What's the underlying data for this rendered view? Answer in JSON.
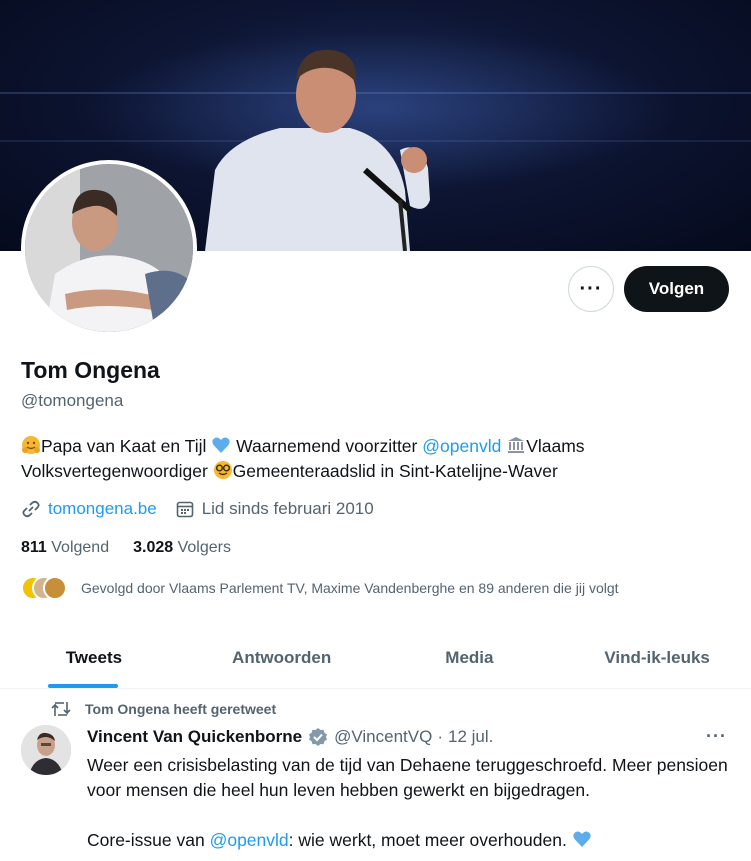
{
  "profile": {
    "name": "Tom Ongena",
    "handle": "@tomongena",
    "bio": {
      "part1": "Papa van Kaat en Tijl",
      "part2": "Waarnemend voorzitter",
      "mention": "@openvld",
      "part3": "Vlaams Volksvertegenwoordiger",
      "part4": "Gemeenteraadslid in Sint-Katelijne-Waver"
    },
    "website": "tomongena.be",
    "joined": "Lid sinds februari 2010",
    "following_count": "811",
    "following_label": "Volgend",
    "followers_count": "3.028",
    "followers_label": "Volgers",
    "followed_by": "Gevolgd door Vlaams Parlement TV, Maxime Vandenberghe en 89 anderen die jij volgt"
  },
  "actions": {
    "more_label": "···",
    "follow_label": "Volgen"
  },
  "tabs": [
    {
      "label": "Tweets",
      "active": true
    },
    {
      "label": "Antwoorden",
      "active": false
    },
    {
      "label": "Media",
      "active": false
    },
    {
      "label": "Vind-ik-leuks",
      "active": false
    }
  ],
  "tweet": {
    "retweeted_by": "Tom Ongena heeft geretweet",
    "author": "Vincent Van Quickenborne",
    "author_handle": "@VincentVQ",
    "separator": "·",
    "date": "12 jul.",
    "line1": "Weer een crisisbelasting van de tijd van Dehaene teruggeschroefd. Meer pensioen voor mensen die heel hun leven hebben gewerkt en bijgedragen.",
    "line2_pre": "Core-issue van",
    "line2_mention": "@openvld",
    "line2_post": ": wie werkt, moet meer overhouden."
  },
  "colors": {
    "accent": "#1d9bf0",
    "text": "#0f1419",
    "muted": "#536471",
    "follow_button": "#0f1419"
  },
  "icons": {
    "link": "link-icon",
    "calendar": "calendar-icon",
    "retweet": "retweet-icon",
    "verified": "verified-badge-icon",
    "more": "more-dots-icon"
  }
}
